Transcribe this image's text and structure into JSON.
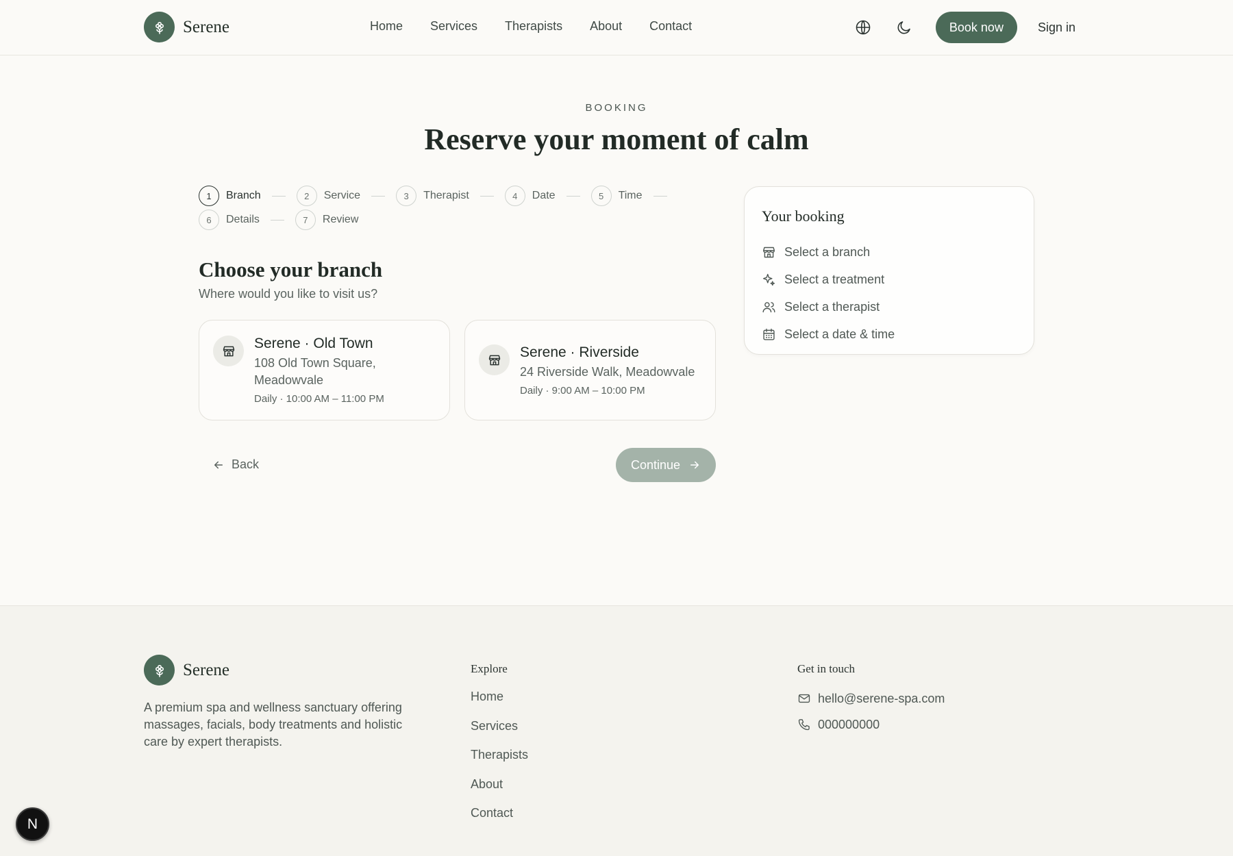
{
  "brand": {
    "name": "Serene",
    "accent": "#4b6a58"
  },
  "nav": {
    "items": [
      "Home",
      "Services",
      "Therapists",
      "About",
      "Contact"
    ]
  },
  "header": {
    "book_label": "Book now",
    "signin_label": "Sign in",
    "icons": [
      "globe-icon",
      "moon-icon"
    ]
  },
  "hero": {
    "eyebrow": "BOOKING",
    "title": "Reserve your moment of calm"
  },
  "steps": [
    {
      "num": "1",
      "label": "Branch",
      "active": true
    },
    {
      "num": "2",
      "label": "Service"
    },
    {
      "num": "3",
      "label": "Therapist"
    },
    {
      "num": "4",
      "label": "Date"
    },
    {
      "num": "5",
      "label": "Time"
    },
    {
      "num": "6",
      "label": "Details"
    },
    {
      "num": "7",
      "label": "Review"
    }
  ],
  "choose": {
    "title": "Choose your branch",
    "subtitle": "Where would you like to visit us?"
  },
  "branches": [
    {
      "name": "Serene · Old Town",
      "address_line1": "108 Old Town Square,",
      "address_line2": "Meadowvale",
      "hours": "Daily · 10:00 AM – 11:00 PM"
    },
    {
      "name": "Serene · Riverside",
      "address_line1": "24 Riverside Walk, Meadowvale",
      "hours": "Daily · 9:00 AM – 10:00 PM"
    }
  ],
  "actions": {
    "back_label": "Back",
    "continue_label": "Continue"
  },
  "summary": {
    "title": "Your booking",
    "items": [
      {
        "icon": "store-icon",
        "label": "Select a branch"
      },
      {
        "icon": "sparkles-icon",
        "label": "Select a treatment"
      },
      {
        "icon": "users-icon",
        "label": "Select a therapist"
      },
      {
        "icon": "calendar-icon",
        "label": "Select a date & time"
      }
    ]
  },
  "footer": {
    "description": "A premium spa and wellness sanctuary offering massages, facials, body treatments and holistic care by expert therapists.",
    "explore_title": "Explore",
    "explore_links": [
      "Home",
      "Services",
      "Therapists",
      "About",
      "Contact"
    ],
    "contact_title": "Get in touch",
    "email": "hello@serene-spa.com",
    "phone": "000000000"
  },
  "badge": {
    "label": "N"
  }
}
